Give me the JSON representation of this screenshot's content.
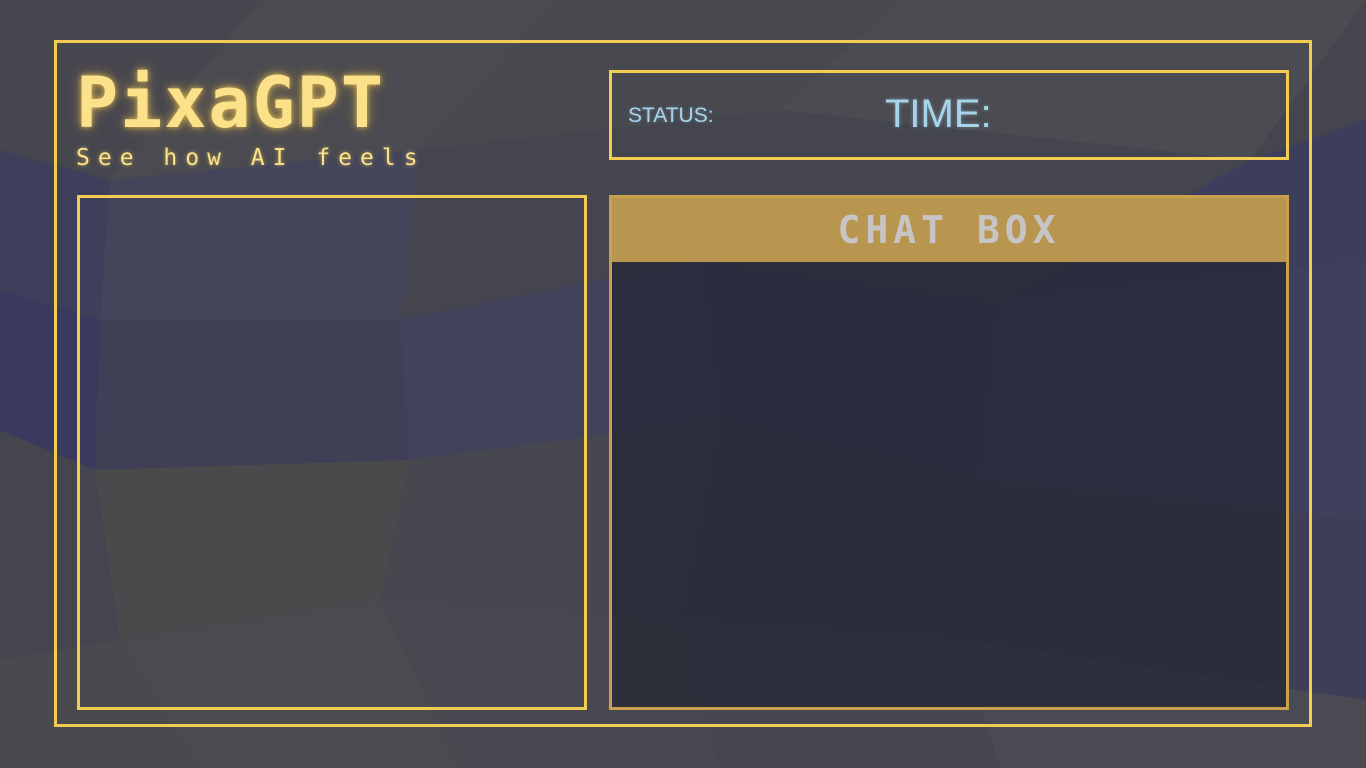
{
  "app": {
    "title": "PixaGPT",
    "tagline": "See how AI feels"
  },
  "status_bar": {
    "status_label": "STATUS:",
    "time_label": "TIME:"
  },
  "chat": {
    "title": "CHAT BOX",
    "messages": []
  },
  "colors": {
    "accent": "#f2cd52",
    "logo_text": "#fbe28a",
    "info_text": "#a7d4ea",
    "chat_header": "#b99650",
    "chat_border": "#c9a04e",
    "chat_title": "#c6c4c4",
    "background": "#44454f"
  }
}
